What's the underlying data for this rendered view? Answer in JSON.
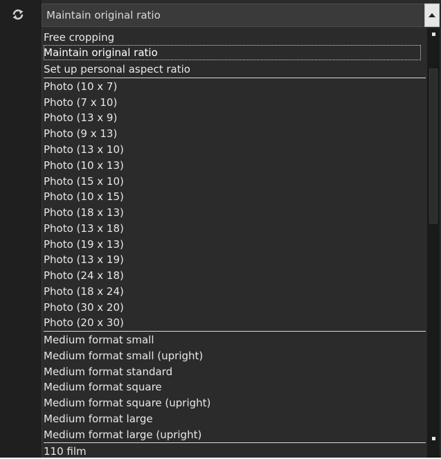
{
  "header": {
    "selected_value": "Maintain original ratio",
    "rotate_icon": "rotate-icon",
    "dropdown_icon": "chevron-up-icon"
  },
  "list": {
    "items": [
      "Free cropping",
      "Maintain original ratio",
      "Set up personal aspect ratio",
      "Photo (10 x 7)",
      "Photo (7 x 10)",
      "Photo (13 x 9)",
      "Photo (9 x 13)",
      "Photo (13 x 10)",
      "Photo (10 x 13)",
      "Photo (15 x 10)",
      "Photo (10 x 15)",
      "Photo (18 x 13)",
      "Photo (13 x 18)",
      "Photo (19 x 13)",
      "Photo (13 x 19)",
      "Photo (24 x 18)",
      "Photo (18 x 24)",
      "Photo (30 x 20)",
      "Photo (20 x 30)",
      "Medium format small",
      "Medium format small (upright)",
      "Medium format standard",
      "Medium format square",
      "Medium format square (upright)",
      "Medium format large",
      "Medium format large (upright)",
      "110 film"
    ]
  },
  "colors": {
    "background": "#2b2b2b",
    "text": "#e8e8e8",
    "separator": "#dcdcdc"
  }
}
